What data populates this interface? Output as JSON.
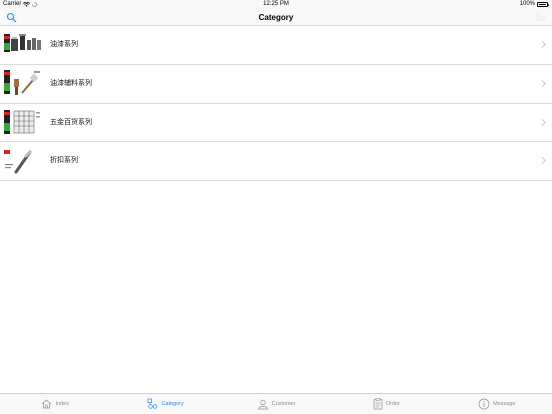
{
  "status_bar": {
    "carrier": "Carrier",
    "time": "12:25 PM",
    "battery": "100%"
  },
  "nav": {
    "title": "Category"
  },
  "categories": [
    {
      "label": "油漆系列"
    },
    {
      "label": "油漆辅料系列"
    },
    {
      "label": "五金百货系列"
    },
    {
      "label": "折扣系列"
    }
  ],
  "tab_bar": {
    "tabs": [
      {
        "label": "Index",
        "icon": "house-icon",
        "active": false
      },
      {
        "label": "Category",
        "icon": "category-icon",
        "active": true
      },
      {
        "label": "Customer",
        "icon": "person-icon",
        "active": false
      },
      {
        "label": "Order",
        "icon": "order-icon",
        "active": false
      },
      {
        "label": "Message",
        "icon": "info-icon",
        "active": false
      }
    ]
  },
  "colors": {
    "accent": "#1a8df5",
    "inactive": "#8e8e93",
    "bar_background": "#f8f8f8"
  }
}
